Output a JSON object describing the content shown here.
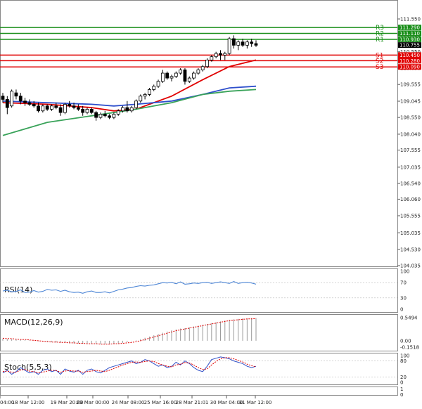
{
  "chart_data": {
    "type": "candlestick",
    "price_axis_ticks": [
      "111.550",
      "111.060",
      "110.550",
      "110.050",
      "109.555",
      "109.045",
      "108.550",
      "108.040",
      "107.555",
      "107.035",
      "106.540",
      "106.060",
      "105.555",
      "105.035",
      "104.530",
      "104.035"
    ],
    "price_range": [
      104.035,
      111.55
    ],
    "x_tick_labels": [
      "04:00",
      "18 Mar 12:00",
      "19 Mar 20:00",
      "23 Mar 00:00",
      "24 Mar 08:00",
      "25 Mar 16:00",
      "28 Mar 21:01",
      "30 Mar 04:00",
      "31 Mar 12:00"
    ],
    "pivot_levels": [
      {
        "name": "R3",
        "value": 111.29,
        "label": "111.290",
        "color": "#1a8f1a"
      },
      {
        "name": "R2",
        "value": 111.11,
        "label": "111.110",
        "color": "#1a8f1a"
      },
      {
        "name": "R1",
        "value": 110.93,
        "label": "110.930",
        "color": "#1a8f1a"
      },
      {
        "name": "S1",
        "value": 110.45,
        "label": "110.450",
        "color": "#e00000"
      },
      {
        "name": "S2",
        "value": 110.28,
        "label": "110.280",
        "color": "#e00000"
      },
      {
        "name": "S3",
        "value": 110.09,
        "label": "110.090",
        "color": "#e00000"
      }
    ],
    "current_price": {
      "value": 110.755,
      "label": "110.755"
    },
    "candles": [
      [
        109.2,
        109.3,
        109.0,
        109.1
      ],
      [
        109.1,
        109.2,
        108.65,
        108.85
      ],
      [
        108.9,
        109.4,
        108.85,
        109.35
      ],
      [
        109.3,
        109.4,
        109.1,
        109.2
      ],
      [
        109.2,
        109.3,
        108.95,
        109.05
      ],
      [
        109.05,
        109.15,
        108.9,
        109.0
      ],
      [
        109.0,
        109.1,
        108.9,
        108.95
      ],
      [
        108.95,
        109.05,
        108.85,
        108.9
      ],
      [
        108.9,
        109.0,
        108.7,
        108.75
      ],
      [
        108.75,
        108.95,
        108.7,
        108.9
      ],
      [
        108.9,
        108.95,
        108.75,
        108.8
      ],
      [
        108.8,
        108.95,
        108.75,
        108.9
      ],
      [
        108.9,
        109.0,
        108.8,
        108.85
      ],
      [
        108.85,
        108.95,
        108.6,
        108.7
      ],
      [
        108.7,
        109.0,
        108.65,
        108.95
      ],
      [
        108.95,
        109.05,
        108.85,
        108.9
      ],
      [
        108.9,
        109.0,
        108.8,
        108.85
      ],
      [
        108.85,
        108.95,
        108.75,
        108.8
      ],
      [
        108.8,
        108.9,
        108.6,
        108.7
      ],
      [
        108.7,
        108.85,
        108.65,
        108.8
      ],
      [
        108.8,
        108.85,
        108.65,
        108.7
      ],
      [
        108.7,
        108.75,
        108.45,
        108.55
      ],
      [
        108.55,
        108.7,
        108.5,
        108.65
      ],
      [
        108.65,
        108.75,
        108.55,
        108.6
      ],
      [
        108.6,
        108.65,
        108.5,
        108.55
      ],
      [
        108.55,
        108.7,
        108.5,
        108.65
      ],
      [
        108.65,
        108.8,
        108.6,
        108.75
      ],
      [
        108.75,
        108.9,
        108.7,
        108.85
      ],
      [
        108.85,
        109.05,
        108.7,
        108.75
      ],
      [
        108.75,
        108.9,
        108.7,
        108.85
      ],
      [
        108.85,
        109.1,
        108.8,
        109.05
      ],
      [
        109.05,
        109.25,
        109.0,
        109.2
      ],
      [
        109.2,
        109.3,
        109.1,
        109.25
      ],
      [
        109.25,
        109.45,
        109.2,
        109.4
      ],
      [
        109.4,
        109.55,
        109.35,
        109.5
      ],
      [
        109.5,
        109.7,
        109.45,
        109.65
      ],
      [
        109.65,
        110.0,
        109.6,
        109.9
      ],
      [
        109.9,
        109.95,
        109.7,
        109.75
      ],
      [
        109.75,
        109.85,
        109.65,
        109.8
      ],
      [
        109.8,
        109.95,
        109.75,
        109.9
      ],
      [
        109.9,
        110.05,
        109.85,
        110.0
      ],
      [
        110.0,
        110.05,
        109.55,
        109.65
      ],
      [
        109.65,
        109.8,
        109.6,
        109.75
      ],
      [
        109.75,
        109.95,
        109.7,
        109.9
      ],
      [
        109.9,
        110.05,
        109.85,
        110.0
      ],
      [
        110.0,
        110.15,
        109.95,
        110.1
      ],
      [
        110.1,
        110.35,
        110.05,
        110.3
      ],
      [
        110.3,
        110.45,
        110.25,
        110.4
      ],
      [
        110.4,
        110.55,
        110.35,
        110.5
      ],
      [
        110.5,
        110.6,
        110.3,
        110.45
      ],
      [
        110.45,
        110.55,
        110.3,
        110.5
      ],
      [
        110.5,
        111.0,
        110.45,
        110.95
      ],
      [
        110.95,
        111.05,
        110.65,
        110.75
      ],
      [
        110.75,
        110.9,
        110.6,
        110.85
      ],
      [
        110.85,
        110.95,
        110.7,
        110.75
      ],
      [
        110.75,
        110.9,
        110.65,
        110.85
      ],
      [
        110.85,
        110.95,
        110.7,
        110.8
      ],
      [
        110.8,
        110.9,
        110.7,
        110.75
      ]
    ],
    "ma_series": [
      {
        "color": "#e00000",
        "points": [
          [
            0,
            109.0
          ],
          [
            10,
            108.95
          ],
          [
            20,
            108.85
          ],
          [
            25,
            108.75
          ],
          [
            30,
            108.8
          ],
          [
            38,
            109.2
          ],
          [
            45,
            109.7
          ],
          [
            51,
            110.1
          ],
          [
            57,
            110.3
          ]
        ]
      },
      {
        "color": "#2e4fcc",
        "points": [
          [
            0,
            109.05
          ],
          [
            10,
            109.0
          ],
          [
            20,
            108.95
          ],
          [
            25,
            108.9
          ],
          [
            30,
            108.95
          ],
          [
            38,
            109.05
          ],
          [
            45,
            109.25
          ],
          [
            51,
            109.45
          ],
          [
            57,
            109.5
          ]
        ]
      },
      {
        "color": "#3aa35a",
        "points": [
          [
            0,
            108.0
          ],
          [
            10,
            108.4
          ],
          [
            20,
            108.6
          ],
          [
            25,
            108.7
          ],
          [
            30,
            108.8
          ],
          [
            38,
            109.0
          ],
          [
            45,
            109.25
          ],
          [
            51,
            109.35
          ],
          [
            57,
            109.4
          ]
        ]
      }
    ],
    "rsi": {
      "label": "RSI(14)",
      "ticks": [
        "100",
        "70",
        "30",
        "0"
      ],
      "color": "#4f87d6",
      "values": [
        48,
        50,
        46,
        47,
        51,
        44,
        45,
        49,
        45,
        47,
        52,
        50,
        51,
        47,
        50,
        46,
        44,
        45,
        42,
        46,
        48,
        44,
        44,
        46,
        43,
        47,
        51,
        53,
        56,
        57,
        60,
        62,
        61,
        63,
        64,
        67,
        70,
        69,
        71,
        67,
        72,
        66,
        67,
        69,
        68,
        70,
        71,
        68,
        70,
        72,
        70,
        68,
        73,
        68,
        70,
        71,
        69,
        66
      ]
    },
    "macd": {
      "label": "MACD(12,26,9)",
      "ticks": [
        "0.5494",
        "0.00",
        "-0.1518"
      ],
      "range": [
        -0.1518,
        0.5494
      ],
      "histogram": [
        0.05,
        0.04,
        0.04,
        0.03,
        0.02,
        0.02,
        0.01,
        0.0,
        -0.01,
        -0.02,
        -0.03,
        -0.03,
        -0.04,
        -0.04,
        -0.05,
        -0.05,
        -0.06,
        -0.06,
        -0.07,
        -0.07,
        -0.07,
        -0.08,
        -0.08,
        -0.08,
        -0.07,
        -0.07,
        -0.06,
        -0.05,
        -0.03,
        -0.01,
        0.01,
        0.04,
        0.07,
        0.1,
        0.13,
        0.16,
        0.19,
        0.22,
        0.25,
        0.27,
        0.29,
        0.3,
        0.32,
        0.34,
        0.36,
        0.38,
        0.4,
        0.42,
        0.44,
        0.46,
        0.48,
        0.5,
        0.51,
        0.52,
        0.53,
        0.53,
        0.54,
        0.54
      ],
      "signal": [
        0.06,
        0.05,
        0.05,
        0.04,
        0.03,
        0.03,
        0.02,
        0.01,
        0.0,
        -0.01,
        -0.02,
        -0.03,
        -0.03,
        -0.04,
        -0.04,
        -0.05,
        -0.05,
        -0.06,
        -0.06,
        -0.07,
        -0.07,
        -0.07,
        -0.08,
        -0.08,
        -0.08,
        -0.07,
        -0.07,
        -0.06,
        -0.05,
        -0.04,
        -0.02,
        0.0,
        0.03,
        0.06,
        0.09,
        0.12,
        0.15,
        0.18,
        0.21,
        0.24,
        0.26,
        0.28,
        0.3,
        0.32,
        0.34,
        0.36,
        0.38,
        0.4,
        0.42,
        0.44,
        0.46,
        0.48,
        0.49,
        0.5,
        0.51,
        0.52,
        0.52,
        0.53
      ]
    },
    "stoch": {
      "label": "Stoch(5,5,3)",
      "ticks": [
        "100",
        "80",
        "20",
        "0"
      ],
      "k": [
        35,
        45,
        30,
        40,
        55,
        45,
        35,
        40,
        30,
        45,
        50,
        40,
        45,
        30,
        50,
        42,
        38,
        45,
        30,
        45,
        50,
        40,
        35,
        45,
        55,
        60,
        65,
        70,
        75,
        80,
        70,
        75,
        85,
        80,
        70,
        60,
        65,
        55,
        60,
        75,
        65,
        80,
        70,
        55,
        45,
        40,
        60,
        85,
        90,
        95,
        92,
        88,
        80,
        75,
        70,
        60,
        55,
        60
      ],
      "d": [
        40,
        42,
        38,
        38,
        46,
        48,
        42,
        40,
        35,
        38,
        42,
        45,
        44,
        38,
        42,
        44,
        42,
        42,
        38,
        40,
        42,
        45,
        42,
        40,
        45,
        52,
        58,
        65,
        70,
        75,
        76,
        75,
        78,
        80,
        78,
        70,
        65,
        60,
        58,
        65,
        68,
        74,
        72,
        65,
        55,
        48,
        50,
        65,
        78,
        88,
        92,
        92,
        88,
        82,
        76,
        68,
        62,
        58
      ]
    },
    "pane5_ticks": [
      "1",
      "0"
    ]
  }
}
